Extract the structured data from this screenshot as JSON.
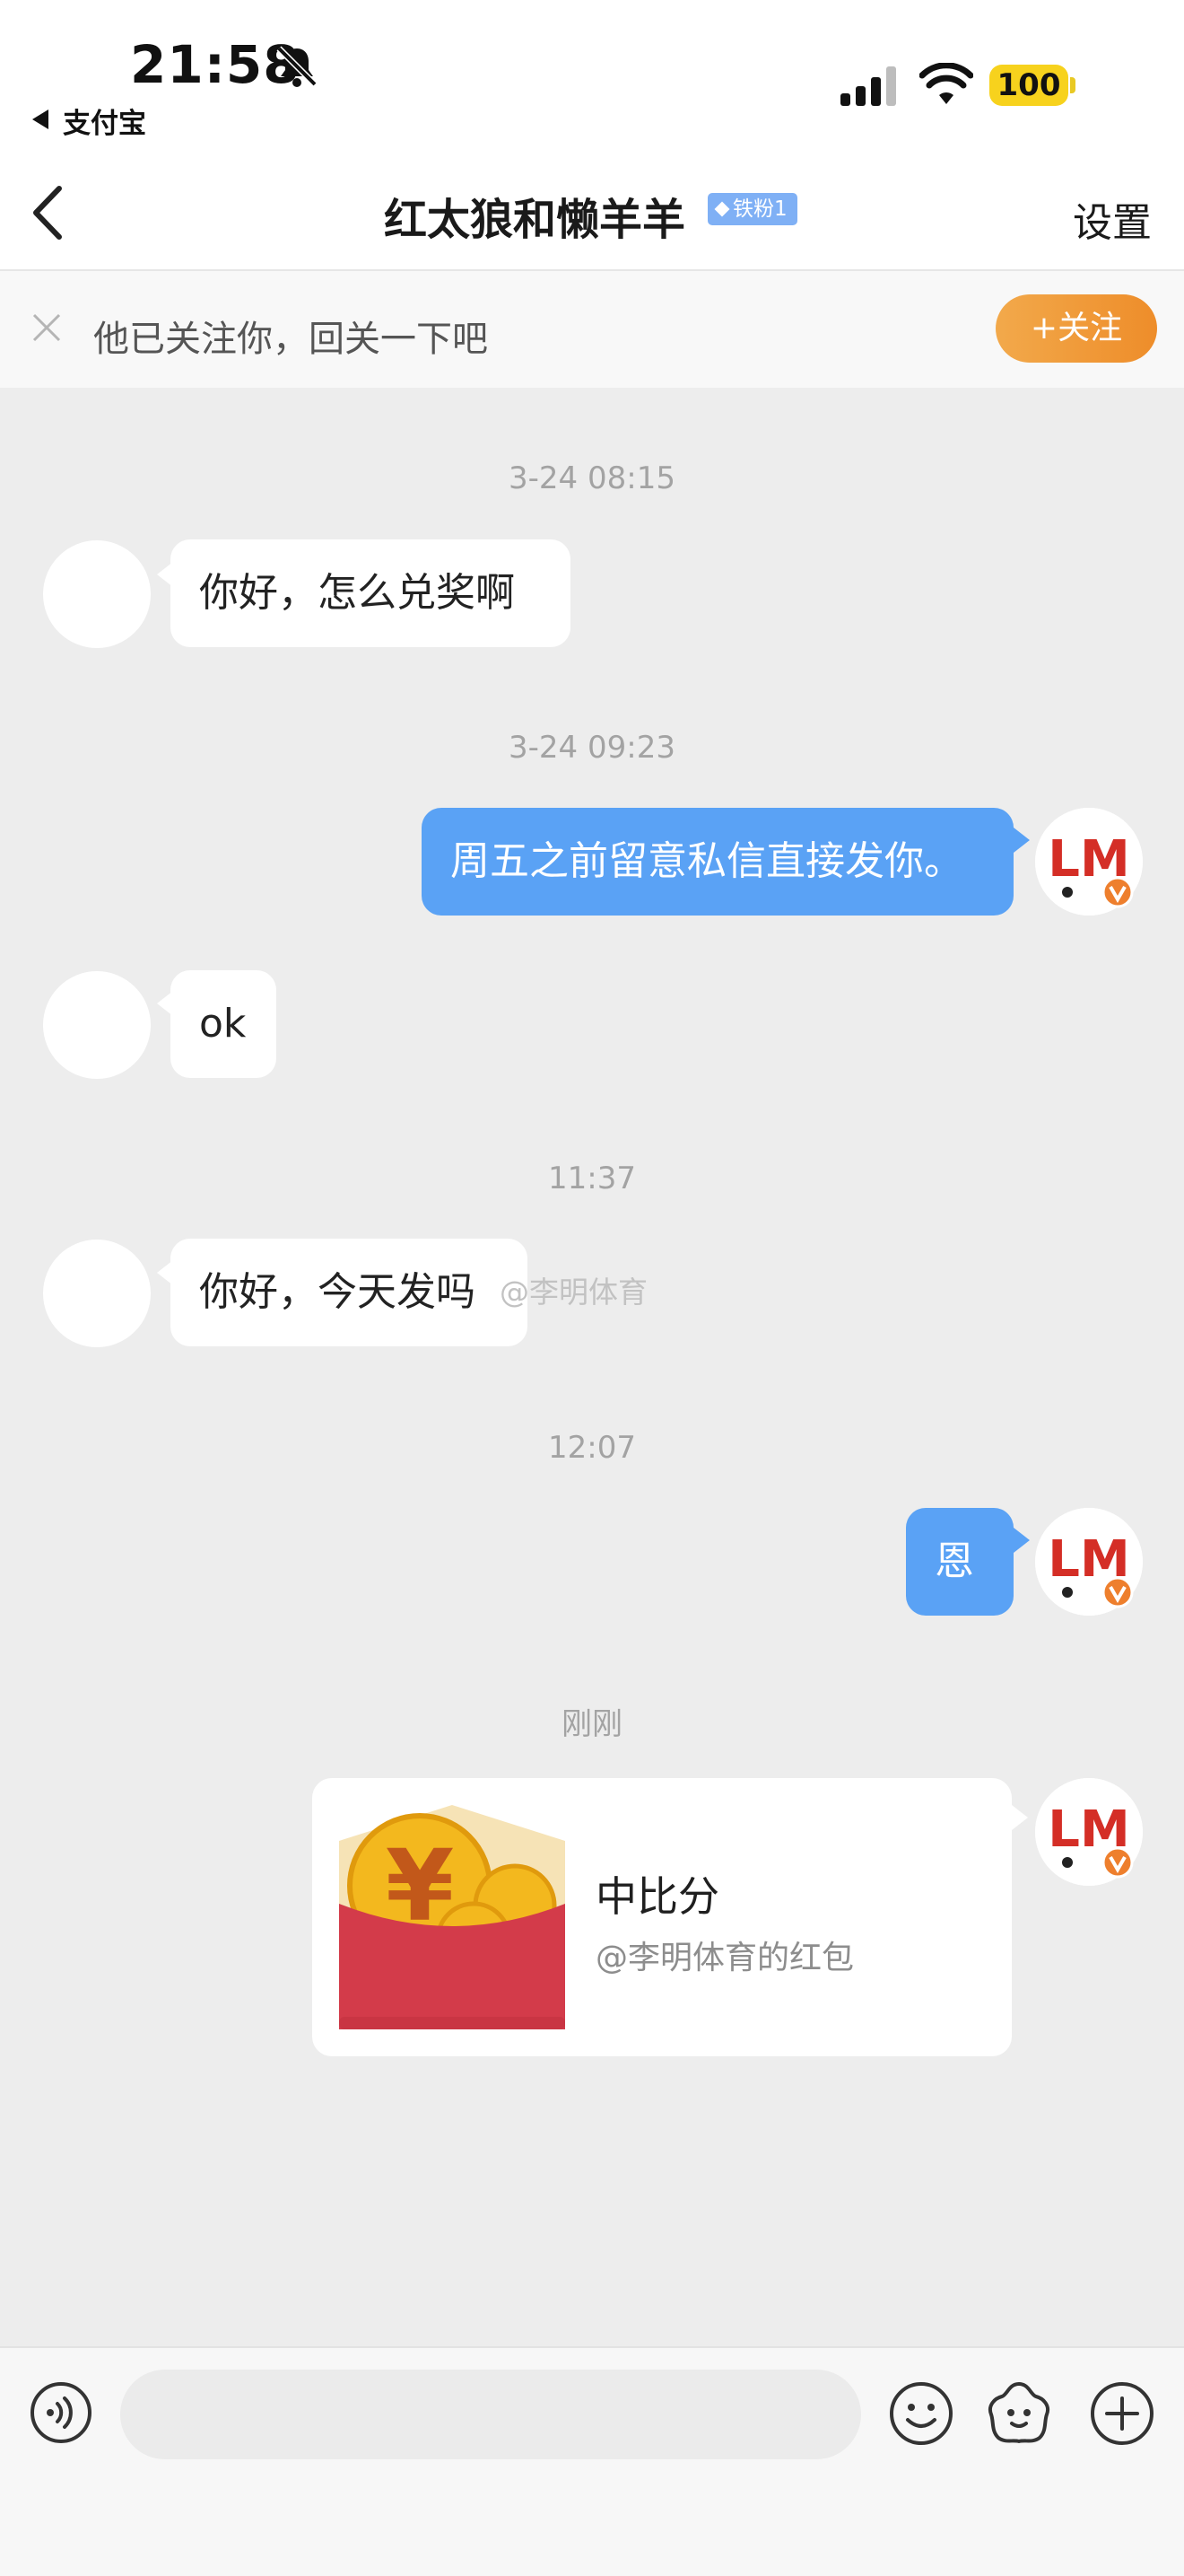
{
  "status_bar": {
    "time": "21:58",
    "back_app": "支付宝",
    "battery": "100"
  },
  "nav": {
    "title": "红太狼和懒羊羊",
    "fan_badge": "铁粉1",
    "settings": "设置"
  },
  "follow_banner": {
    "text": "他已关注你，回关一下吧",
    "button": "+关注"
  },
  "messages": [
    {
      "timestamp": "3-24 08:15",
      "from": "them",
      "text": "你好，怎么兑奖啊"
    },
    {
      "timestamp": "3-24 09:23",
      "from": "me",
      "text": "周五之前留意私信直接发你。"
    },
    {
      "from": "them",
      "text": "ok"
    },
    {
      "timestamp": "11:37",
      "from": "them",
      "text": "你好，今天发吗"
    },
    {
      "timestamp": "12:07",
      "from": "me",
      "text": "恩"
    },
    {
      "timestamp": "刚刚",
      "from": "me",
      "type": "red_packet"
    }
  ],
  "red_packet": {
    "title": "中比分",
    "subtitle": "@李明体育的红包"
  },
  "avatar_letters": "LM",
  "watermark": "@李明体育",
  "input_bar": {
    "placeholder": ""
  },
  "colors": {
    "accent_blue": "#5aa2f5",
    "follow_orange": "#ee8d2a",
    "battery_yellow": "#f7d21d",
    "red_packet": "#d33b4a"
  },
  "icons": [
    "bell-slash-icon",
    "signal-icon",
    "wifi-icon",
    "back-chevron-icon",
    "close-icon",
    "voice-icon",
    "emoji-icon",
    "sticker-icon",
    "plus-icon"
  ]
}
